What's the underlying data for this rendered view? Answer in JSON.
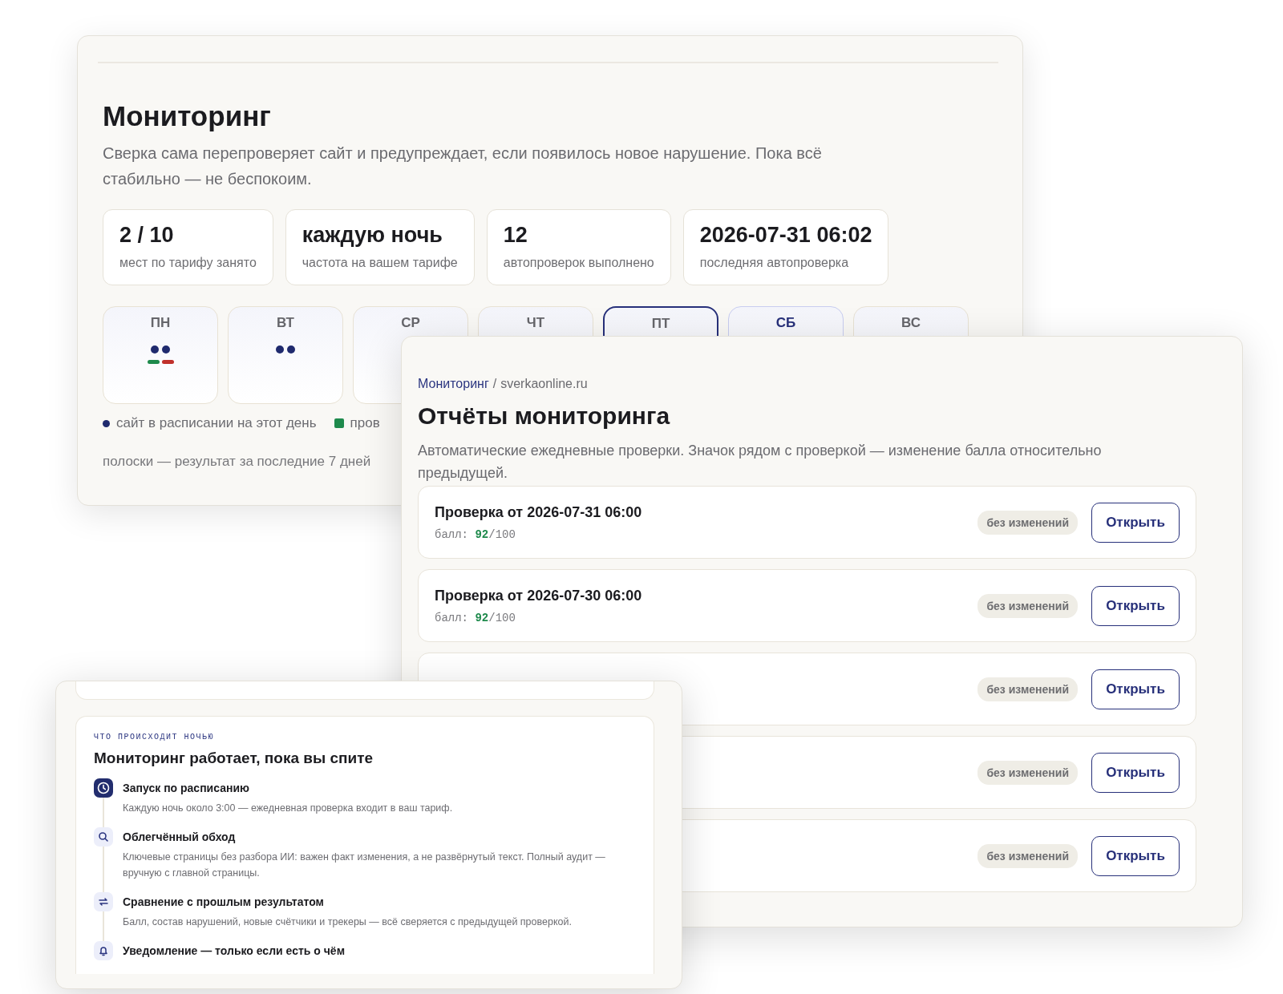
{
  "monitoring": {
    "title": "Мониторинг",
    "description": "Сверка сама перепроверяет сайт и предупреждает, если появилось новое нарушение. Пока всё стабильно — не беспокоим.",
    "stats": [
      {
        "value": "2 / 10",
        "label": "мест по тарифу занято"
      },
      {
        "value": "каждую ночь",
        "label": "частота на вашем тарифе"
      },
      {
        "value": "12",
        "label": "автопроверок выполнено"
      },
      {
        "value": "2026-07-31 06:02",
        "label": "последняя автопроверка"
      }
    ],
    "days": [
      {
        "label": "ПН",
        "selected": false,
        "upcoming": false,
        "dots": [
          {
            "color": "#1f2a6e"
          },
          {
            "color": "#1f2a6e"
          }
        ],
        "bars": [
          {
            "color": "#1e8a4c"
          },
          {
            "color": "#c0302b"
          }
        ]
      },
      {
        "label": "ВТ",
        "selected": false,
        "upcoming": false,
        "dots": [
          {
            "color": "#1f2a6e"
          },
          {
            "color": "#1f2a6e"
          }
        ]
      },
      {
        "label": "СР",
        "selected": false,
        "upcoming": false
      },
      {
        "label": "ЧТ",
        "selected": false,
        "upcoming": false
      },
      {
        "label": "ПТ",
        "selected": true,
        "upcoming": false
      },
      {
        "label": "СБ",
        "selected": false,
        "upcoming": true
      },
      {
        "label": "ВС",
        "selected": false,
        "upcoming": false
      }
    ],
    "legend": [
      {
        "kind": "dot",
        "color": "#1f2a6e",
        "text": "сайт в расписании на этот день"
      },
      {
        "kind": "square",
        "color": "#1e8a4c",
        "text": "пров"
      }
    ],
    "footnote": "полоски — результат за последние 7 дней"
  },
  "reports": {
    "breadcrumb": {
      "link": "Мониторинг",
      "separator": "/",
      "current": "sverkaonline.ru"
    },
    "title": "Отчёты мониторинга",
    "description": "Автоматические ежедневные проверки. Значок рядом с проверкой — изменение балла относительно предыдущей.",
    "rows": [
      {
        "title": "Проверка от 2026-07-31 06:00",
        "score": {
          "label": "балл:",
          "value": "92",
          "max": "/100"
        },
        "badge": "без изменений",
        "button": "Открыть"
      },
      {
        "title": "Проверка от 2026-07-30 06:00",
        "score": {
          "label": "балл:",
          "value": "92",
          "max": "/100"
        },
        "badge": "без изменений",
        "button": "Открыть"
      },
      {
        "badge": "без изменений",
        "button": "Открыть"
      },
      {
        "badge": "без изменений",
        "button": "Открыть"
      },
      {
        "badge": "без изменений",
        "button": "Открыть"
      }
    ]
  },
  "night": {
    "eyebrow": "ЧТО ПРОИСХОДИТ НОЧЬЮ",
    "title": "Мониторинг работает, пока вы спите",
    "steps": [
      {
        "kind": "clock",
        "active": true,
        "title": "Запуск по расписанию",
        "text": "Каждую ночь около 3:00 — ежедневная проверка входит в ваш тариф."
      },
      {
        "kind": "search",
        "active": false,
        "title": "Облегчённый обход",
        "text": "Ключевые страницы без разбора ИИ: важен факт изменения, а не развёрнутый текст. Полный аудит — вручную с главной страницы."
      },
      {
        "kind": "compare",
        "active": false,
        "title": "Сравнение с прошлым результатом",
        "text": "Балл, состав нарушений, новые счётчики и трекеры — всё сверяется с предыдущей проверкой."
      },
      {
        "kind": "bell",
        "active": false,
        "title": "Уведомление — только если есть о чём"
      }
    ]
  }
}
